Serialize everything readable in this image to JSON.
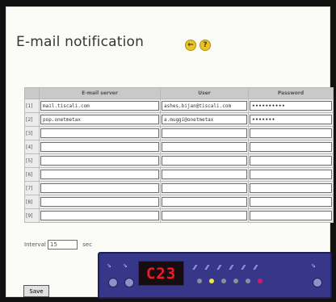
{
  "page": {
    "title": "E-mail notification",
    "help_icons": [
      {
        "glyph": "←"
      },
      {
        "glyph": "?"
      }
    ]
  },
  "table": {
    "headers": [
      "",
      "E-mail server",
      "User",
      "Password"
    ],
    "rows": [
      {
        "index": "[1]",
        "server": "mail.tiscali.com",
        "user": "ashes.bijan@tiscali.com",
        "password": "••••••••••"
      },
      {
        "index": "[2]",
        "server": "pop.onetmetax",
        "user": "a.muggi@onetmetax",
        "password": "•••••••"
      },
      {
        "index": "[3]",
        "server": "",
        "user": "",
        "password": ""
      },
      {
        "index": "[4]",
        "server": "",
        "user": "",
        "password": ""
      },
      {
        "index": "[5]",
        "server": "",
        "user": "",
        "password": ""
      },
      {
        "index": "[6]",
        "server": "",
        "user": "",
        "password": ""
      },
      {
        "index": "[7]",
        "server": "",
        "user": "",
        "password": ""
      },
      {
        "index": "[8]",
        "server": "",
        "user": "",
        "password": ""
      },
      {
        "index": "[9]",
        "server": "",
        "user": "",
        "password": ""
      }
    ]
  },
  "interval": {
    "label": "Interval",
    "value": "15",
    "unit": "sec"
  },
  "actions": {
    "save_label": "Save"
  },
  "device": {
    "display_text": "C23"
  }
}
